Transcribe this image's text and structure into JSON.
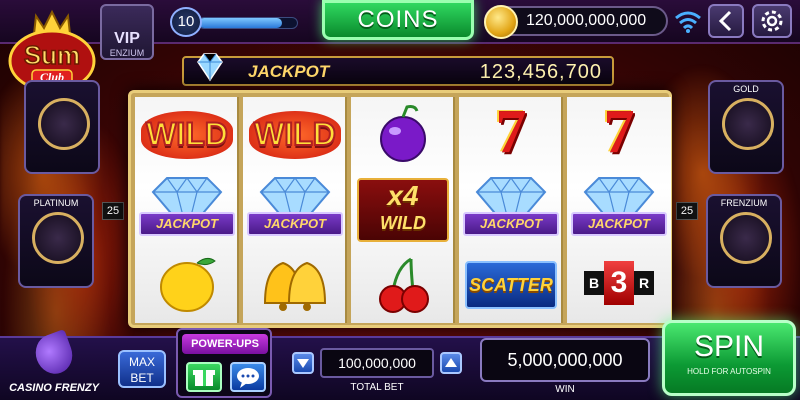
{
  "top": {
    "level": "10",
    "level_progress": 0.85,
    "vip_label": "VIP",
    "vip_sub": "ENZIUM",
    "coins_button": "COINS",
    "coin_balance": "120,000,000,000"
  },
  "logo": {
    "brand_top": "Sum",
    "brand_bottom": "Club"
  },
  "jackpot": {
    "label": "JACKPOT",
    "value": "123,456,700"
  },
  "reels": {
    "wild": "WILD",
    "jackpot_ribbon": "JACKPOT",
    "x4": "x4",
    "x4_wild": "WILD",
    "scatter": "SCATTER",
    "b3r_left": "B",
    "b3r_mid": "3",
    "b3r_right": "R",
    "seven": "7"
  },
  "side": {
    "platinum": "PLATINUM",
    "gold": "GOLD",
    "frenzium": "FRENZIUM",
    "left_num": "25",
    "right_num": "25"
  },
  "bottom": {
    "casino_frenzy": "CASINO FRENZY",
    "max_bet_line1": "MAX",
    "max_bet_line2": "BET",
    "powerups": "POWER-UPS",
    "total_bet_value": "100,000,000",
    "total_bet_label": "TOTAL BET",
    "win_value": "5,000,000,000",
    "win_label": "WIN",
    "spin": "SPIN",
    "spin_sub": "HOLD FOR AUTOSPIN"
  },
  "colors": {
    "coins_green": "#0a8a2c",
    "spin_green": "#0c9a34",
    "jackpot_gold": "#ffd76a",
    "bg_red": "#7a0e0e"
  }
}
